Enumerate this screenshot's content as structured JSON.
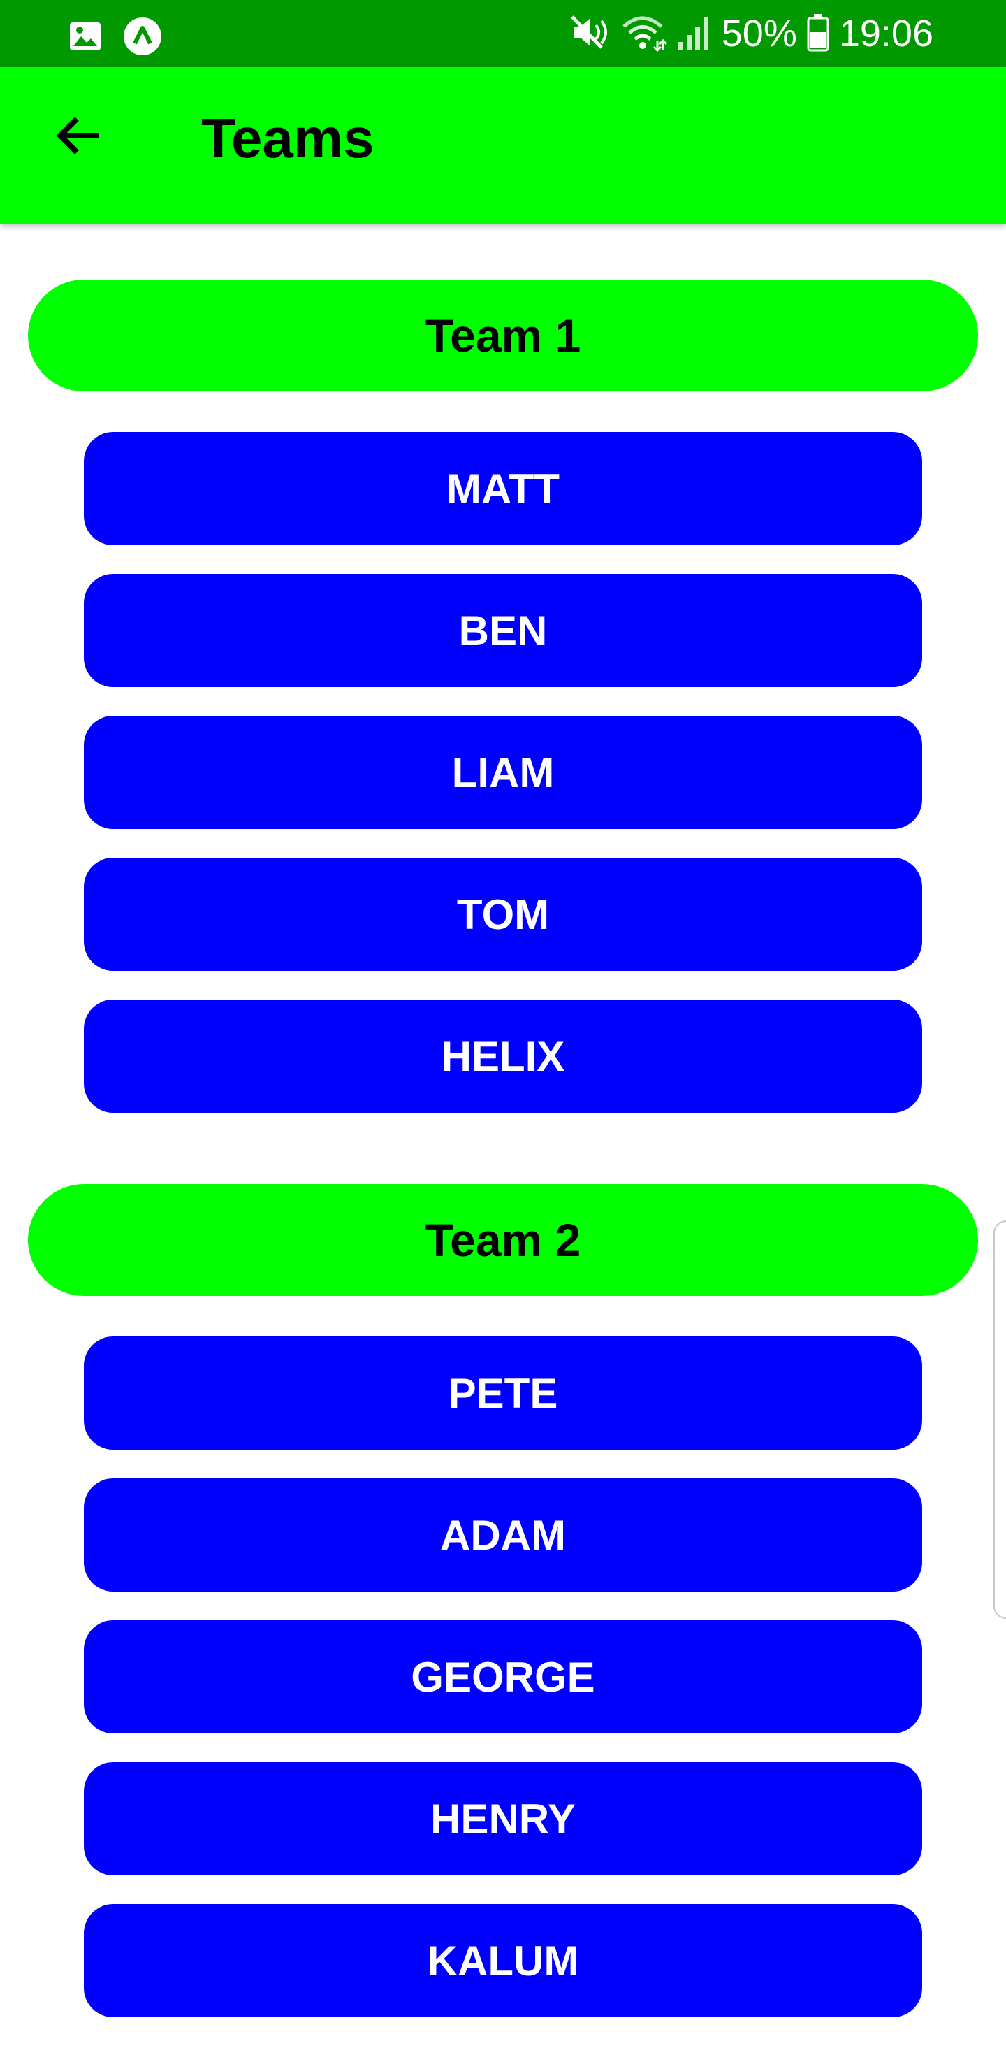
{
  "status_bar": {
    "battery": "50%",
    "time": "19:06",
    "icons": [
      "gallery-icon",
      "app-a-icon",
      "mute-icon",
      "wifi-icon",
      "cell-signal-icon",
      "battery-icon"
    ]
  },
  "app_bar": {
    "title": "Teams",
    "back_icon": "arrow-back-icon"
  },
  "teams": [
    {
      "name": "Team 1",
      "players": [
        "MATT",
        "BEN",
        "LIAM",
        "TOM",
        "HELIX"
      ]
    },
    {
      "name": "Team 2",
      "players": [
        "PETE",
        "ADAM",
        "GEORGE",
        "HENRY",
        "KALUM"
      ]
    }
  ],
  "colors": {
    "status_bar": "#009a00",
    "accent": "#00ff00",
    "button": "#0000ff"
  }
}
